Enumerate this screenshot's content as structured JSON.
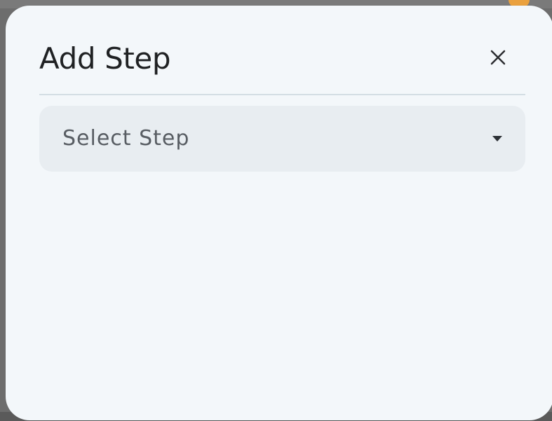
{
  "dialog": {
    "title": "Add Step",
    "close_icon": "close-icon"
  },
  "select_step": {
    "placeholder": "Select Step",
    "chevron_icon": "chevron-down-icon"
  },
  "colors": {
    "dialog_background": "#f3f7fa",
    "field_background": "#e8edf1",
    "divider": "#d4dee4",
    "title_text": "#1f2123",
    "placeholder_text": "#585d63",
    "badge_orange": "#f0a33b"
  }
}
